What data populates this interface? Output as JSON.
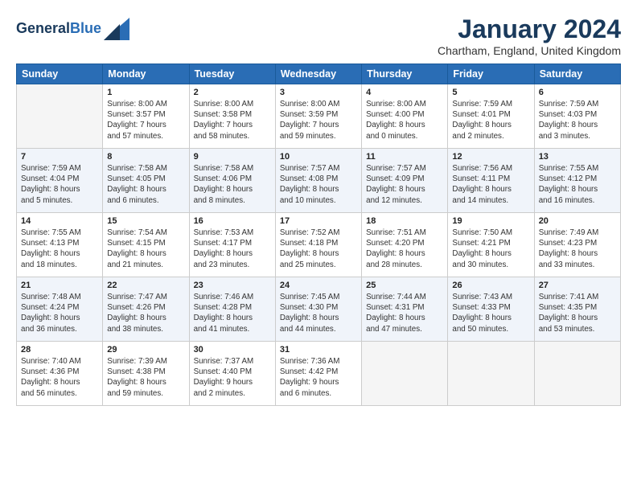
{
  "header": {
    "logo_line1": "General",
    "logo_line2": "Blue",
    "title": "January 2024",
    "location": "Chartham, England, United Kingdom"
  },
  "days_of_week": [
    "Sunday",
    "Monday",
    "Tuesday",
    "Wednesday",
    "Thursday",
    "Friday",
    "Saturday"
  ],
  "weeks": [
    [
      {
        "day": "",
        "content": ""
      },
      {
        "day": "1",
        "content": "Sunrise: 8:00 AM\nSunset: 3:57 PM\nDaylight: 7 hours\nand 57 minutes."
      },
      {
        "day": "2",
        "content": "Sunrise: 8:00 AM\nSunset: 3:58 PM\nDaylight: 7 hours\nand 58 minutes."
      },
      {
        "day": "3",
        "content": "Sunrise: 8:00 AM\nSunset: 3:59 PM\nDaylight: 7 hours\nand 59 minutes."
      },
      {
        "day": "4",
        "content": "Sunrise: 8:00 AM\nSunset: 4:00 PM\nDaylight: 8 hours\nand 0 minutes."
      },
      {
        "day": "5",
        "content": "Sunrise: 7:59 AM\nSunset: 4:01 PM\nDaylight: 8 hours\nand 2 minutes."
      },
      {
        "day": "6",
        "content": "Sunrise: 7:59 AM\nSunset: 4:03 PM\nDaylight: 8 hours\nand 3 minutes."
      }
    ],
    [
      {
        "day": "7",
        "content": "Sunrise: 7:59 AM\nSunset: 4:04 PM\nDaylight: 8 hours\nand 5 minutes."
      },
      {
        "day": "8",
        "content": "Sunrise: 7:58 AM\nSunset: 4:05 PM\nDaylight: 8 hours\nand 6 minutes."
      },
      {
        "day": "9",
        "content": "Sunrise: 7:58 AM\nSunset: 4:06 PM\nDaylight: 8 hours\nand 8 minutes."
      },
      {
        "day": "10",
        "content": "Sunrise: 7:57 AM\nSunset: 4:08 PM\nDaylight: 8 hours\nand 10 minutes."
      },
      {
        "day": "11",
        "content": "Sunrise: 7:57 AM\nSunset: 4:09 PM\nDaylight: 8 hours\nand 12 minutes."
      },
      {
        "day": "12",
        "content": "Sunrise: 7:56 AM\nSunset: 4:11 PM\nDaylight: 8 hours\nand 14 minutes."
      },
      {
        "day": "13",
        "content": "Sunrise: 7:55 AM\nSunset: 4:12 PM\nDaylight: 8 hours\nand 16 minutes."
      }
    ],
    [
      {
        "day": "14",
        "content": "Sunrise: 7:55 AM\nSunset: 4:13 PM\nDaylight: 8 hours\nand 18 minutes."
      },
      {
        "day": "15",
        "content": "Sunrise: 7:54 AM\nSunset: 4:15 PM\nDaylight: 8 hours\nand 21 minutes."
      },
      {
        "day": "16",
        "content": "Sunrise: 7:53 AM\nSunset: 4:17 PM\nDaylight: 8 hours\nand 23 minutes."
      },
      {
        "day": "17",
        "content": "Sunrise: 7:52 AM\nSunset: 4:18 PM\nDaylight: 8 hours\nand 25 minutes."
      },
      {
        "day": "18",
        "content": "Sunrise: 7:51 AM\nSunset: 4:20 PM\nDaylight: 8 hours\nand 28 minutes."
      },
      {
        "day": "19",
        "content": "Sunrise: 7:50 AM\nSunset: 4:21 PM\nDaylight: 8 hours\nand 30 minutes."
      },
      {
        "day": "20",
        "content": "Sunrise: 7:49 AM\nSunset: 4:23 PM\nDaylight: 8 hours\nand 33 minutes."
      }
    ],
    [
      {
        "day": "21",
        "content": "Sunrise: 7:48 AM\nSunset: 4:24 PM\nDaylight: 8 hours\nand 36 minutes."
      },
      {
        "day": "22",
        "content": "Sunrise: 7:47 AM\nSunset: 4:26 PM\nDaylight: 8 hours\nand 38 minutes."
      },
      {
        "day": "23",
        "content": "Sunrise: 7:46 AM\nSunset: 4:28 PM\nDaylight: 8 hours\nand 41 minutes."
      },
      {
        "day": "24",
        "content": "Sunrise: 7:45 AM\nSunset: 4:30 PM\nDaylight: 8 hours\nand 44 minutes."
      },
      {
        "day": "25",
        "content": "Sunrise: 7:44 AM\nSunset: 4:31 PM\nDaylight: 8 hours\nand 47 minutes."
      },
      {
        "day": "26",
        "content": "Sunrise: 7:43 AM\nSunset: 4:33 PM\nDaylight: 8 hours\nand 50 minutes."
      },
      {
        "day": "27",
        "content": "Sunrise: 7:41 AM\nSunset: 4:35 PM\nDaylight: 8 hours\nand 53 minutes."
      }
    ],
    [
      {
        "day": "28",
        "content": "Sunrise: 7:40 AM\nSunset: 4:36 PM\nDaylight: 8 hours\nand 56 minutes."
      },
      {
        "day": "29",
        "content": "Sunrise: 7:39 AM\nSunset: 4:38 PM\nDaylight: 8 hours\nand 59 minutes."
      },
      {
        "day": "30",
        "content": "Sunrise: 7:37 AM\nSunset: 4:40 PM\nDaylight: 9 hours\nand 2 minutes."
      },
      {
        "day": "31",
        "content": "Sunrise: 7:36 AM\nSunset: 4:42 PM\nDaylight: 9 hours\nand 6 minutes."
      },
      {
        "day": "",
        "content": ""
      },
      {
        "day": "",
        "content": ""
      },
      {
        "day": "",
        "content": ""
      }
    ]
  ]
}
